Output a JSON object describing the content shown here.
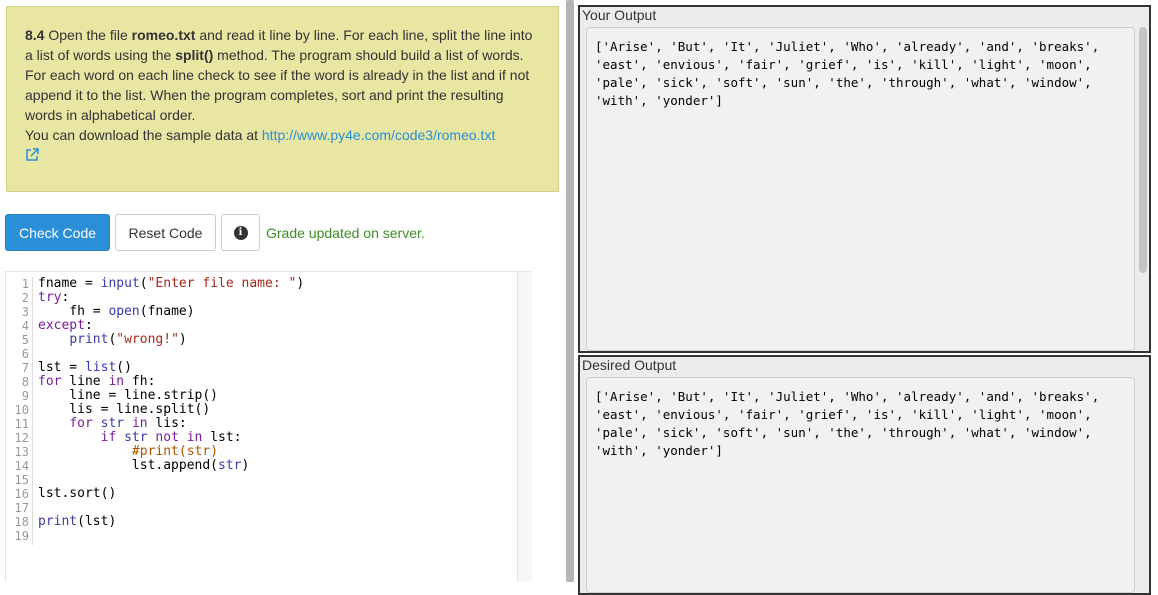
{
  "problem": {
    "number": "8.4",
    "text_1": " Open the file ",
    "file_name": "romeo.txt",
    "text_2": " and read it line by line. For each line, split the line into a list of words using the ",
    "method_name": "split()",
    "text_3": " method. The program should build a list of words. For each word on each line check to see if the word is already in the list and if not append it to the list. When the program completes, sort and print the resulting words in alphabetical order.",
    "download_text": "You can download the sample data at ",
    "download_link": "http://www.py4e.com/code3/romeo.txt"
  },
  "toolbar": {
    "check_label": "Check Code",
    "reset_label": "Reset Code",
    "info_glyph": "i",
    "status": "Grade updated on server."
  },
  "editor": {
    "line_numbers": [
      "1",
      "2",
      "3",
      "4",
      "5",
      "6",
      "7",
      "8",
      "9",
      "10",
      "11",
      "12",
      "13",
      "14",
      "15",
      "16",
      "17",
      "18",
      "19"
    ]
  },
  "output": {
    "your_label": "Your Output",
    "your_text": "['Arise', 'But', 'It', 'Juliet', 'Who', 'already', 'and', 'breaks', 'east', 'envious', 'fair', 'grief', 'is', 'kill', 'light', 'moon', 'pale', 'sick', 'soft', 'sun', 'the', 'through', 'what', 'window', 'with', 'yonder']",
    "desired_label": "Desired Output",
    "desired_text": "['Arise', 'But', 'It', 'Juliet', 'Who', 'already', 'and', 'breaks', 'east', 'envious', 'fair', 'grief', 'is', 'kill', 'light', 'moon', 'pale', 'sick', 'soft', 'sun', 'the', 'through', 'what', 'window', 'with', 'yonder']"
  },
  "colors": {
    "problem_bg": "#e8e6a3",
    "primary_button": "#2a8fd6",
    "status_green": "#3c8c25",
    "link": "#2a8fd6"
  }
}
